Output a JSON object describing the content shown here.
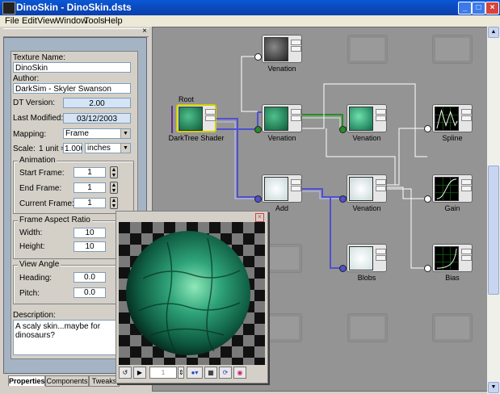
{
  "window": {
    "title": "DinoSkin - DinoSkin.dsts",
    "min": "_",
    "max": "□",
    "close": "×"
  },
  "menu": [
    "File",
    "Edit",
    "View",
    "Window",
    "Tools",
    "Help"
  ],
  "panel": {
    "close_glyph": "×",
    "texture_name_label": "Texture Name:",
    "texture_name": "DinoSkin",
    "author_label": "Author:",
    "author": "DarkSim - Skyler Swanson",
    "dt_version_label": "DT Version:",
    "dt_version": "2.00",
    "last_modified_label": "Last Modified:",
    "last_modified": "03/12/2003",
    "mapping_label": "Mapping:",
    "mapping": "Frame",
    "scale_label": "Scale:",
    "scale_unit_text": "1 unit =",
    "scale_value": "1.000",
    "scale_units": "inches",
    "animation": {
      "title": "Animation",
      "start_label": "Start Frame:",
      "start": "1",
      "end_label": "End Frame:",
      "end": "1",
      "current_label": "Current Frame:",
      "current": "1"
    },
    "aspect": {
      "title": "Frame Aspect Ratio",
      "width_label": "Width:",
      "width": "10",
      "height_label": "Height:",
      "height": "10"
    },
    "view_angle": {
      "title": "View Angle",
      "heading_label": "Heading:",
      "heading": "0.0",
      "pitch_label": "Pitch:",
      "pitch": "0.0"
    },
    "description_label": "Description:",
    "description": "A scaly skin...maybe for dinosaurs?",
    "tabs": [
      "Properties",
      "Components",
      "Tweaks"
    ]
  },
  "graph": {
    "root_label": "Root",
    "nodes": {
      "dts": "DarkTree Shader",
      "venation_top": "Venation",
      "venation_mid": "Venation",
      "venation_right": "Venation",
      "spline": "Spline",
      "add": "Add",
      "venation_low": "Venation",
      "gain": "Gain",
      "blobs": "Blobs",
      "bias": "Bias"
    }
  },
  "preview": {
    "close_glyph": "×",
    "frame": "1"
  },
  "colors": {
    "titlebar": "#0a4cc0",
    "panel_border": "#a5b4c4",
    "canvas": "#949494",
    "wire_blue": "#5050d0",
    "wire_green": "#2a8a2a",
    "wire_white": "#ffffff"
  }
}
